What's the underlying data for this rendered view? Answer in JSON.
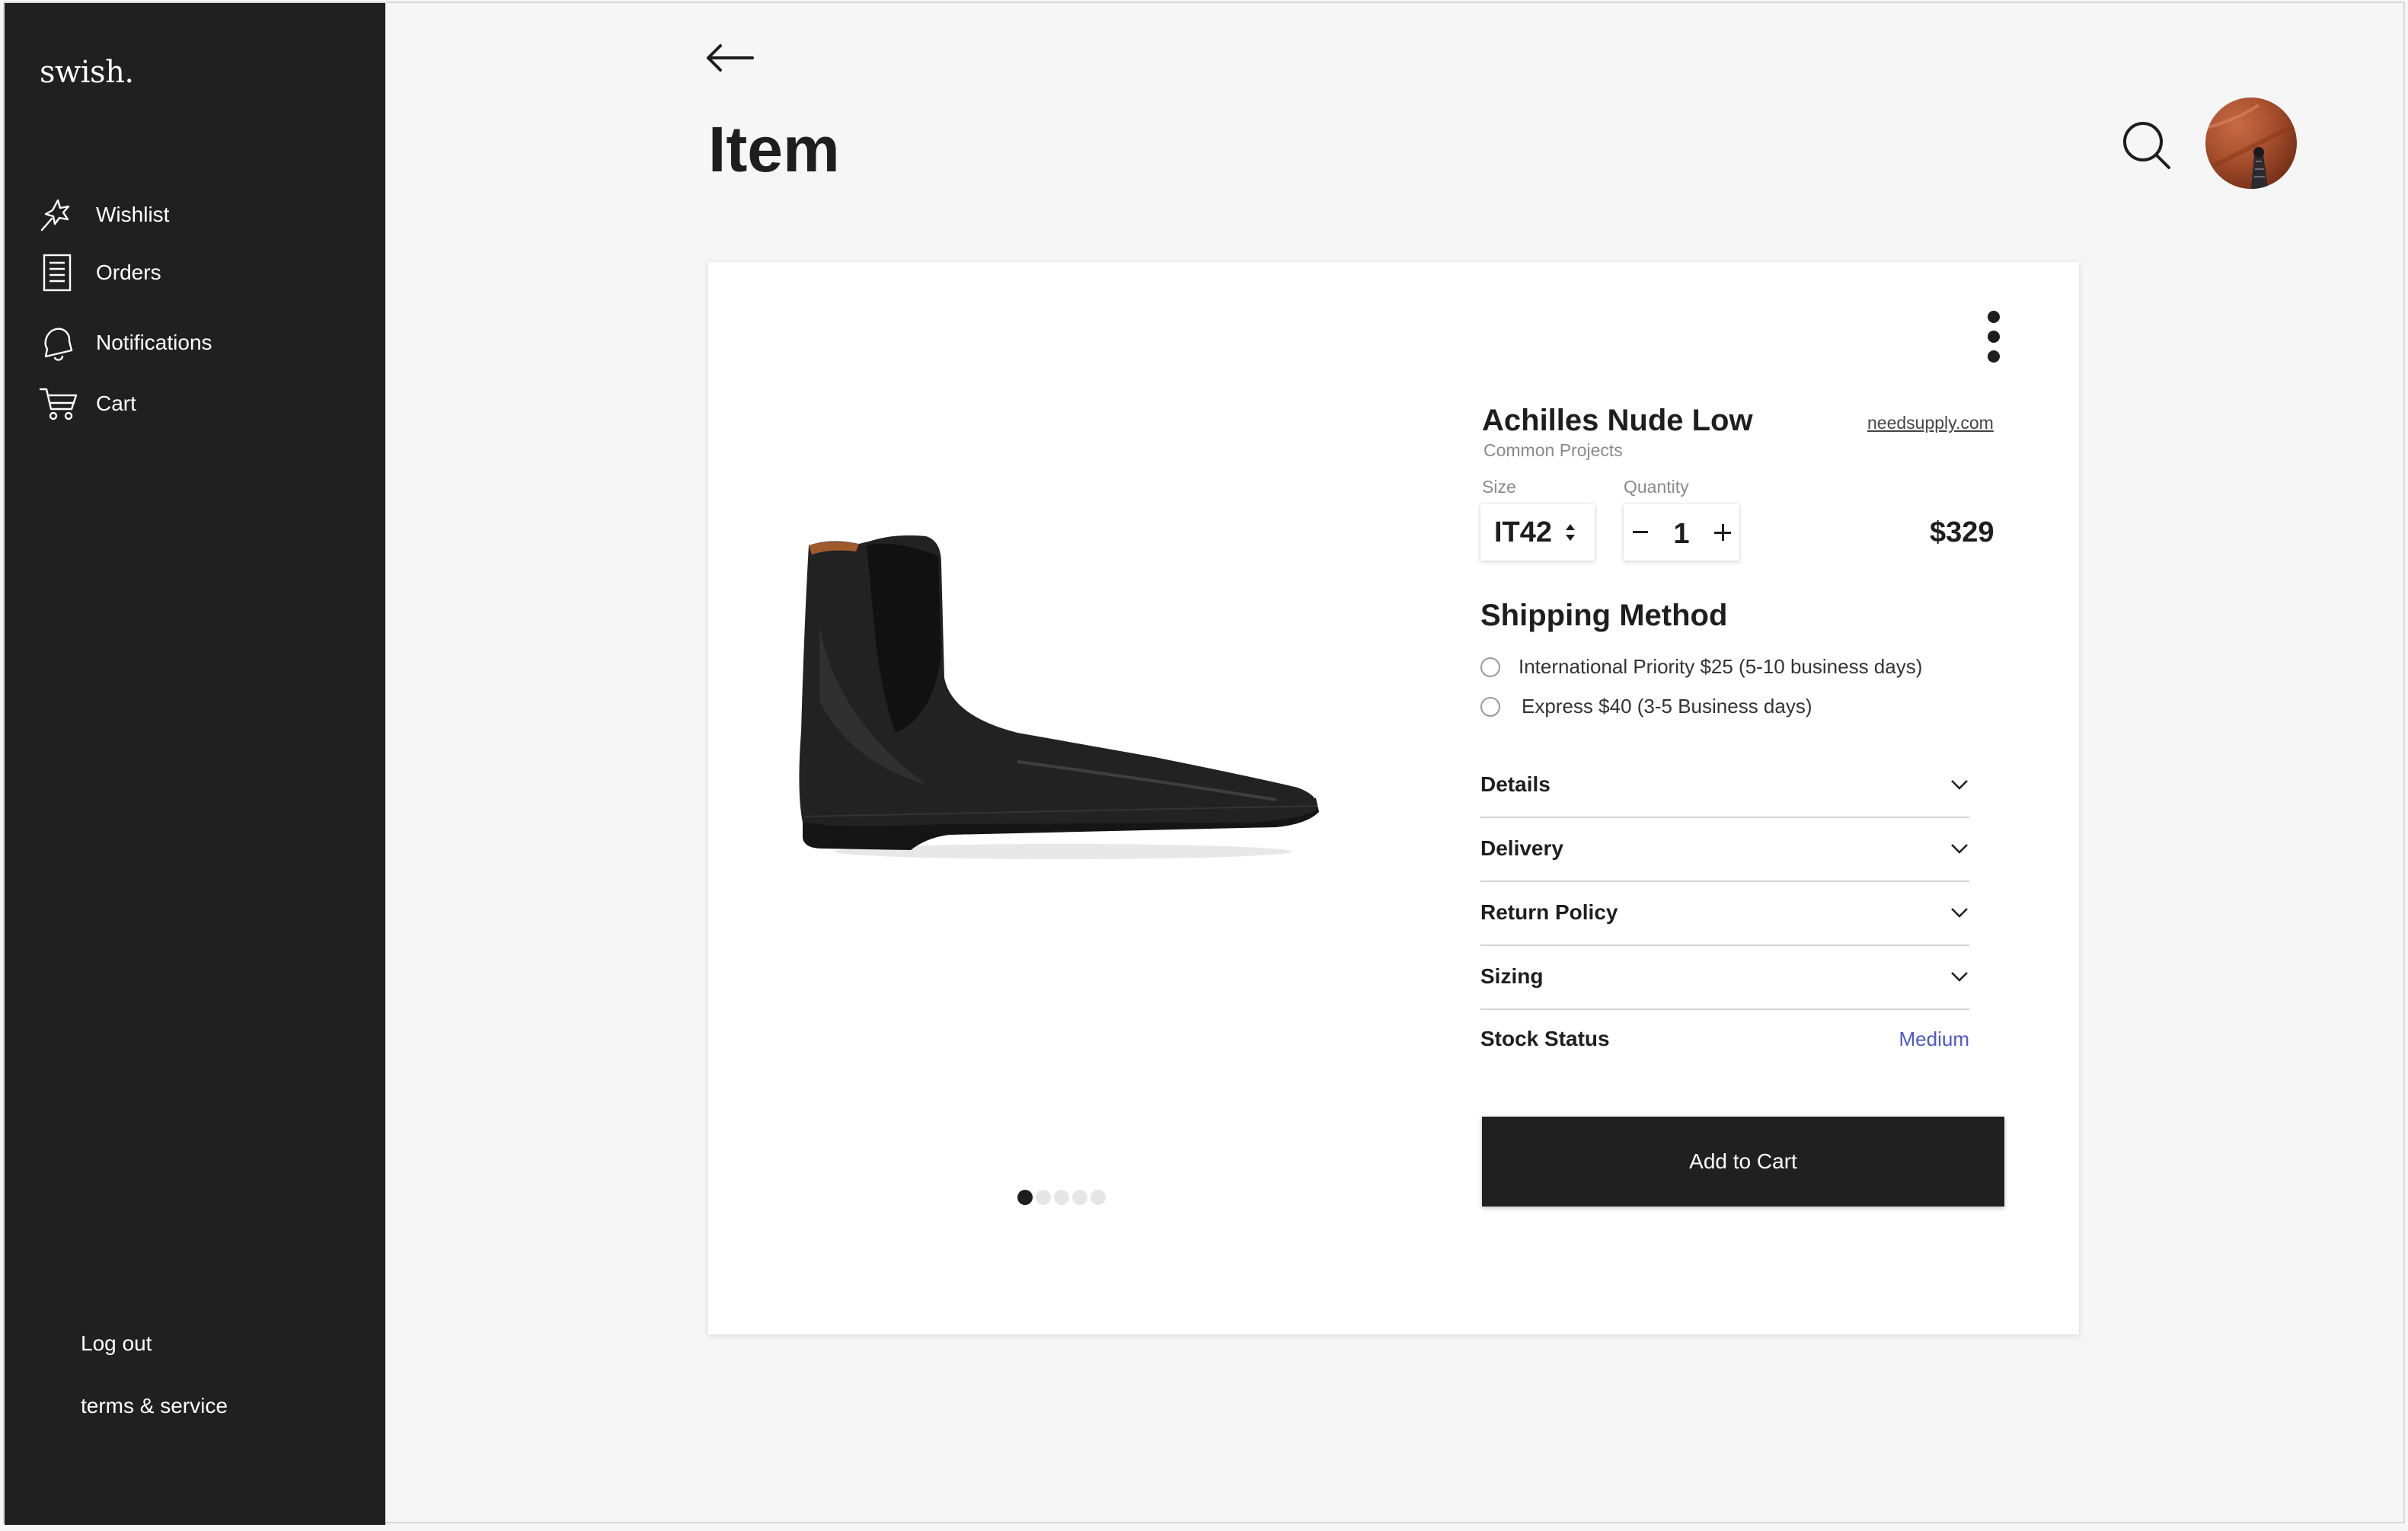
{
  "app": {
    "logo": "swish."
  },
  "sidebar": {
    "items": [
      {
        "label": "Wishlist",
        "icon": "wishlist-icon"
      },
      {
        "label": "Orders",
        "icon": "orders-icon"
      },
      {
        "label": "Notifications",
        "icon": "bell-icon"
      },
      {
        "label": "Cart",
        "icon": "cart-icon"
      }
    ],
    "logout_label": "Log out",
    "terms_label": "terms & service"
  },
  "header": {
    "title": "Item",
    "back_icon": "arrow-left-icon",
    "search_icon": "search-icon"
  },
  "product": {
    "name": "Achilles Nude Low",
    "brand": "Common Projects",
    "store": "needsupply.com",
    "size_label": "Size",
    "size_value": "IT42",
    "quantity_label": "Quantity",
    "quantity": "1",
    "price": "$329",
    "image_count": 5,
    "active_image": 1
  },
  "shipping": {
    "title": "Shipping Method",
    "options": [
      {
        "label": "International Priority $25 (5-10 business days)",
        "selected": false
      },
      {
        "label": "Express $40 (3-5 Business days)",
        "selected": false
      }
    ]
  },
  "accordion": [
    {
      "label": "Details"
    },
    {
      "label": "Delivery"
    },
    {
      "label": "Return Policy"
    },
    {
      "label": "Sizing"
    }
  ],
  "stock": {
    "label": "Stock Status",
    "value": "Medium"
  },
  "cta": {
    "add_to_cart": "Add to Cart"
  },
  "colors": {
    "sidebar_bg": "#202020",
    "page_bg": "#f6f6f6",
    "accent_stock": "#5058c8",
    "button_bg": "#202020"
  }
}
